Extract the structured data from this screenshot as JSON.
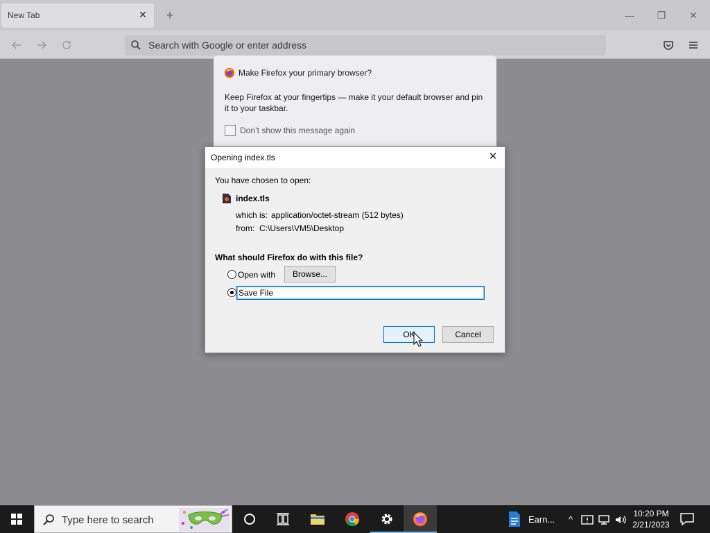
{
  "browser": {
    "tab_title": "New Tab",
    "tab_close_glyph": "✕",
    "new_tab_glyph": "+",
    "window_controls": {
      "minimize": "—",
      "restore": "❐",
      "close": "✕"
    },
    "address_placeholder": "Search with Google or enter address",
    "icons": [
      "back-icon",
      "forward-icon",
      "reload-icon",
      "search-icon",
      "pocket-icon",
      "menu-icon"
    ]
  },
  "notification": {
    "title": "Make Firefox your primary browser?",
    "body": "Keep Firefox at your fingertips — make it your default browser and pin it to your taskbar.",
    "checkbox_label": "Don’t show this message again"
  },
  "dialog": {
    "title": "Opening index.tls",
    "close_glyph": "✕",
    "intro": "You have chosen to open:",
    "file_name": "index.tls",
    "which_is_label": "which is:",
    "which_is_value": "application/octet-stream (512 bytes)",
    "from_label": "from:",
    "from_value": "C:\\Users\\VM5\\Desktop",
    "question": "What should Firefox do with this file?",
    "open_with_label": "Open with",
    "browse_label": "Browse...",
    "save_file_label": "Save File",
    "selected_option": "Save File",
    "ok_label": "OK",
    "cancel_label": "Cancel"
  },
  "taskbar": {
    "search_placeholder": "Type here to search",
    "earn_label": "Earn...",
    "time": "10:20 PM",
    "date": "2/21/2023",
    "tray_chevron": "^",
    "colors": {
      "bar": "#1b1b1b",
      "active_indicator": "#76b9ed",
      "dialog_focus": "#0078d7"
    }
  }
}
